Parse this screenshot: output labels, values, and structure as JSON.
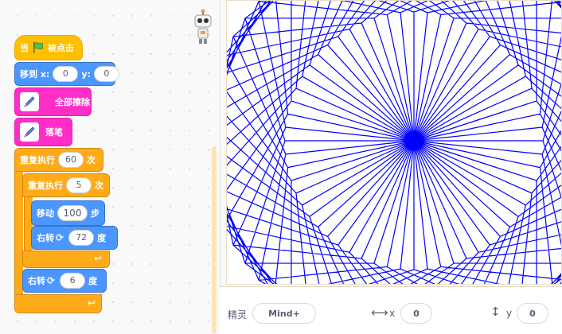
{
  "blocks": {
    "when_flag": {
      "prefix": "当",
      "suffix": "被点击"
    },
    "goto": {
      "label": "移到 x:",
      "x_value": "0",
      "y_label": "y:",
      "y_value": "0"
    },
    "clear": {
      "label": "全部擦除"
    },
    "pen_up": {
      "label": "落笔"
    },
    "repeat_outer": {
      "label": "重复执行",
      "count": "60",
      "unit": "次"
    },
    "repeat_inner": {
      "label": "重复执行",
      "count": "5",
      "unit": "次"
    },
    "move": {
      "label": "移动",
      "value": "100",
      "unit": "步"
    },
    "turn_inner": {
      "label": "右转",
      "value": "72",
      "unit": "度"
    },
    "turn_outer": {
      "label": "右转",
      "value": "6",
      "unit": "度"
    }
  },
  "stage": {
    "pen_color": "#0000ff",
    "outer_repeats": 60,
    "inner_repeats": 5,
    "step": 100,
    "inner_turn": 72,
    "outer_turn": 6
  },
  "sprite_info": {
    "sprite_label": "精灵",
    "sprite_name": "Mind+",
    "x_label": "x",
    "x_value": "0",
    "y_label": "y",
    "y_value": "0"
  },
  "colors": {
    "events": "#ffbf00",
    "motion": "#4c97ff",
    "pen": "#ff2ec8",
    "control": "#ffab19"
  }
}
